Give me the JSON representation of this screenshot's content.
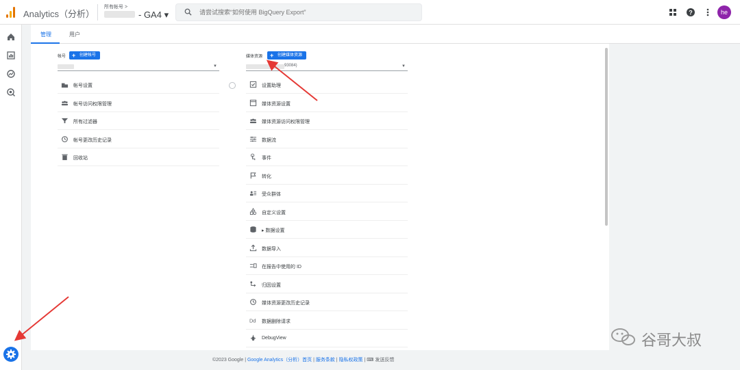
{
  "app": {
    "title": "Analytics（分析）",
    "account_crumb": "所有帐号 >",
    "property_name": "- GA4 ▾",
    "avatar_initials": "he"
  },
  "search": {
    "placeholder": "请尝试搜索“如何使用 BigQuery Export”"
  },
  "tabs": [
    {
      "label": "管理",
      "active": true
    },
    {
      "label": "用户",
      "active": false
    }
  ],
  "account_column": {
    "label": "帐号",
    "create_button": "创建帐号",
    "items": [
      {
        "label": "帐号设置",
        "icon": "building-icon"
      },
      {
        "label": "帐号访问权限管理",
        "icon": "people-icon"
      },
      {
        "label": "所有过滤器",
        "icon": "filter-icon"
      },
      {
        "label": "帐号更改历史记录",
        "icon": "history-icon"
      },
      {
        "label": "回收站",
        "icon": "trash-icon"
      }
    ]
  },
  "property_column": {
    "label": "媒体资源",
    "create_button": "创建媒体资源",
    "selected_suffix": "93084)",
    "items": [
      {
        "label": "设置助理",
        "icon": "checkbox-icon"
      },
      {
        "label": "媒体资源设置",
        "icon": "window-icon"
      },
      {
        "label": "媒体资源访问权限管理",
        "icon": "people-icon"
      },
      {
        "label": "数据流",
        "icon": "streams-icon"
      },
      {
        "label": "事件",
        "icon": "touch-icon"
      },
      {
        "label": "转化",
        "icon": "flag-icon"
      },
      {
        "label": "受众群体",
        "icon": "audience-icon"
      },
      {
        "label": "自定义设置",
        "icon": "shapes-icon"
      },
      {
        "label": "▸ 数据设置",
        "icon": "database-icon"
      },
      {
        "label": "数据导入",
        "icon": "upload-icon"
      },
      {
        "label": "在报告中使用的 ID",
        "icon": "id-icon"
      },
      {
        "label": "归因设置",
        "icon": "attribution-icon"
      },
      {
        "label": "媒体资源更改历史记录",
        "icon": "history-icon"
      },
      {
        "label": "数据删除请求",
        "icon": "dd-icon"
      },
      {
        "label": "DebugView",
        "icon": "debug-icon"
      }
    ]
  },
  "footer": {
    "copyright": "©2023 Google | ",
    "home_link": "Google Analytics（分析）首页",
    "sep1": " | ",
    "terms_link": "服务条款",
    "sep2": " | ",
    "privacy_link": "隐私权政策",
    "sep3": " | ",
    "feedback": "发送反馈"
  },
  "watermark": {
    "text": "谷哥大叔"
  },
  "colors": {
    "accent": "#1a73e8",
    "avatar": "#8e24aa",
    "arrow": "#e53935",
    "logo_orange": "#e37400",
    "logo_yellow": "#f9ab00"
  }
}
